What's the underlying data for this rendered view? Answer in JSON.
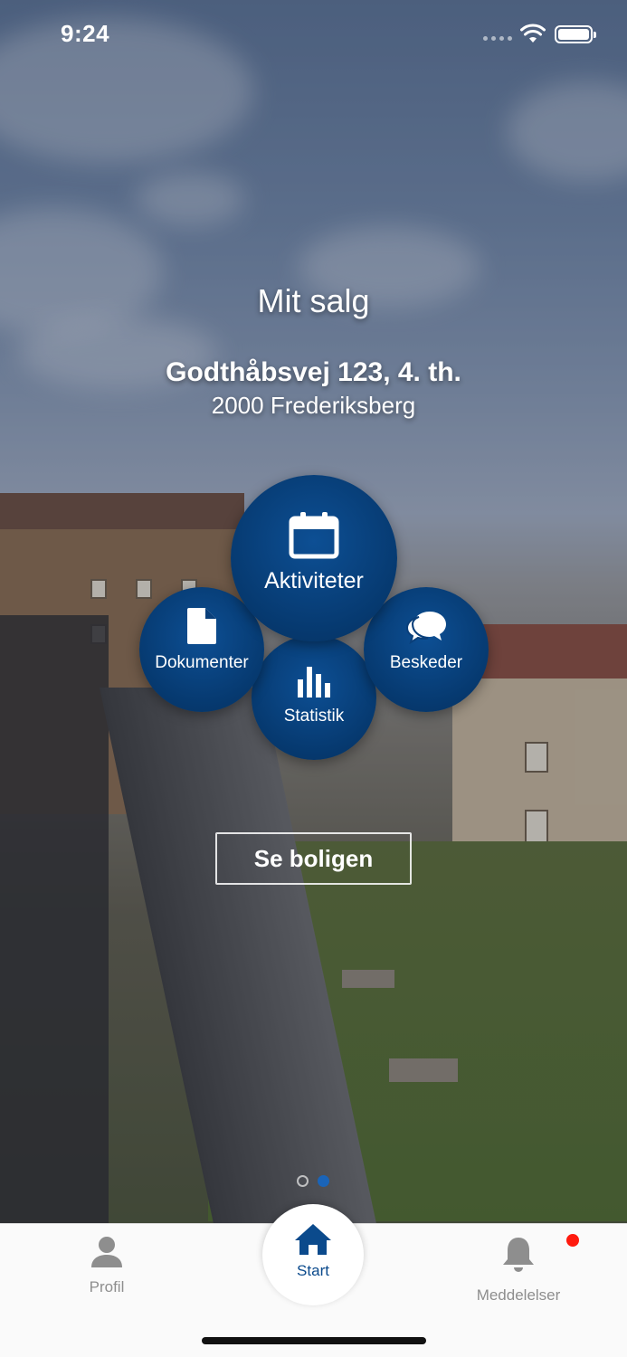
{
  "status_bar": {
    "time": "9:24"
  },
  "header": {
    "title": "Mit salg",
    "address_line1": "Godthåbsvej 123, 4. th.",
    "address_line2": "2000 Frederiksberg"
  },
  "menu": {
    "activities": {
      "label": "Aktiviteter",
      "icon": "calendar-icon"
    },
    "documents": {
      "label": "Dokumenter",
      "icon": "document-icon"
    },
    "messages": {
      "label": "Beskeder",
      "icon": "chat-bubbles-icon"
    },
    "statistics": {
      "label": "Statistik",
      "icon": "bar-chart-icon"
    }
  },
  "see_property_button": "Se boligen",
  "pager": {
    "pages": 2,
    "active_index": 1
  },
  "tabbar": {
    "profile": {
      "label": "Profil",
      "icon": "person-icon"
    },
    "start": {
      "label": "Start",
      "icon": "home-icon"
    },
    "notifications": {
      "label": "Meddelelser",
      "icon": "bell-icon",
      "has_badge": true
    }
  },
  "colors": {
    "primary": "#06396f",
    "active_tab": "#0b4a8c",
    "badge": "#ff1a0e",
    "inactive_tab": "#8e8e8e"
  }
}
